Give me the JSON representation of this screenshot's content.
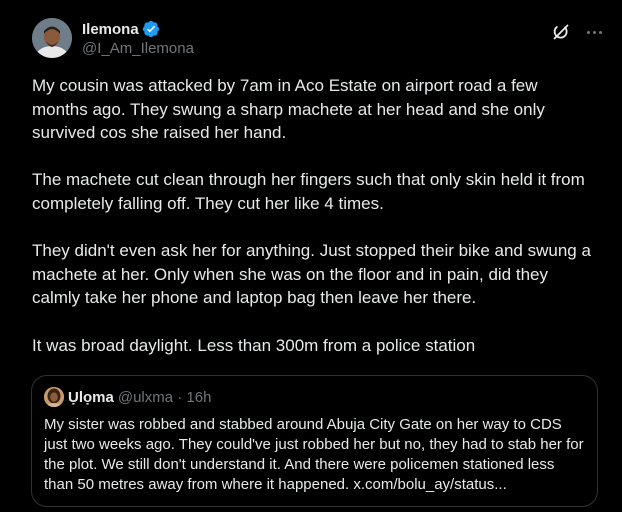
{
  "post": {
    "author": {
      "display_name": "Ilemona",
      "handle": "@I_Am_Ilemona",
      "verified": true
    },
    "icons": {
      "avatar": "profile-photo",
      "verified": "verified-badge-icon",
      "grok": "grok-icon",
      "more": "more-icon"
    },
    "paragraphs": [
      "My cousin was attacked by 7am in Aco Estate on airport road a few months ago. They swung a sharp machete at her head and she only survived cos she raised her hand.",
      "The machete cut clean through her fingers such that only skin held it from completely falling off. They cut her like 4 times.",
      "They didn't even ask her for anything. Just stopped their bike and swung a machete at her. Only when she was on the floor and in pain, did they calmly take her phone and laptop bag then leave her there.",
      "It was broad daylight. Less than 300m from a police station"
    ],
    "quote": {
      "display_name": "Ụlọma",
      "handle_time": "@ulxma · 16h",
      "text": "My sister was robbed and stabbed around Abuja City Gate on her way to CDS just two weeks ago. They could've just robbed her but no, they had to stab her for the plot. We still don't understand it. And there were policemen stationed less than 50 metres away from where it happened. x.com/bolu_ay/status..."
    }
  },
  "colors": {
    "background": "#000000",
    "text_primary": "#e7e9ea",
    "text_secondary": "#71767b",
    "verified_blue": "#1d9bf0",
    "border": "#2f3336"
  }
}
